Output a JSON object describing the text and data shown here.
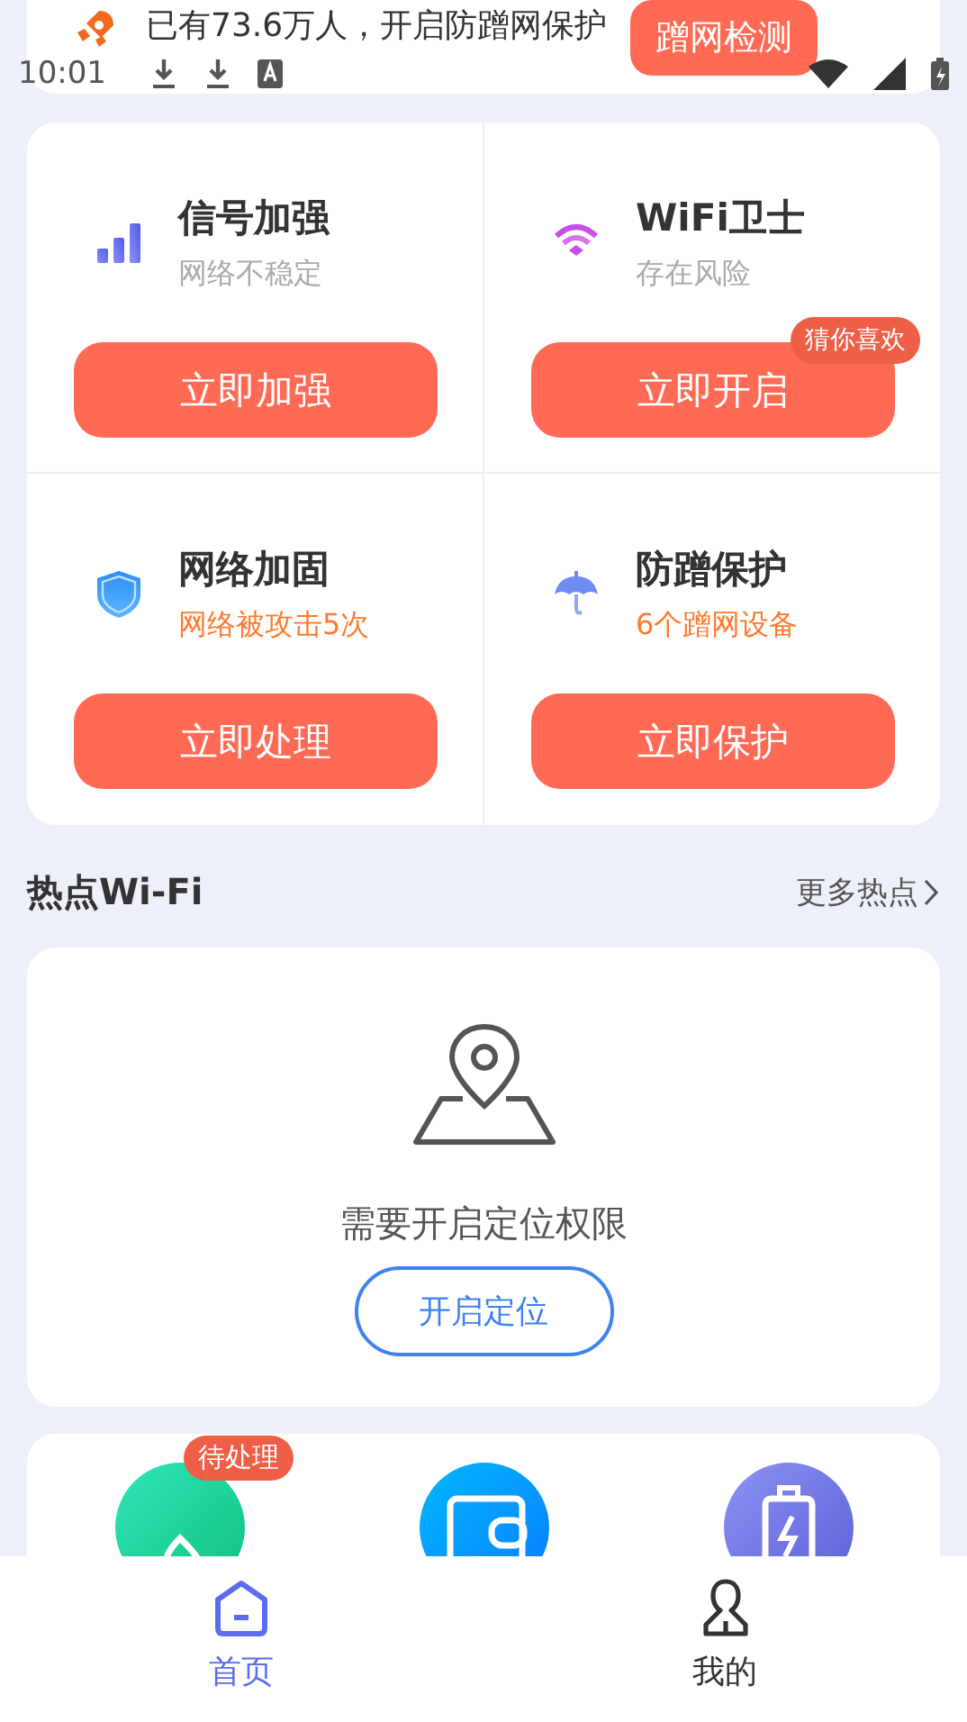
{
  "status_bar": {
    "time": "10:01"
  },
  "banner": {
    "text": "已有73.6万人，开启防蹭网保护",
    "button": "蹭网检测"
  },
  "tools": [
    {
      "kind": "signal",
      "title": "信号加强",
      "subtitle": "网络不稳定",
      "alert": false,
      "button": "立即加强"
    },
    {
      "kind": "wifi",
      "title": "WiFi卫士",
      "subtitle": "存在风险",
      "alert": false,
      "button": "立即开启",
      "badge": "猜你喜欢"
    },
    {
      "kind": "shield",
      "title": "网络加固",
      "subtitle": "网络被攻击5次",
      "alert": true,
      "button": "立即处理"
    },
    {
      "kind": "umbrella",
      "title": "防蹭保护",
      "subtitle": "6个蹭网设备",
      "alert": true,
      "button": "立即保护"
    }
  ],
  "hotspot": {
    "title": "热点Wi-Fi",
    "more_link": "更多热点",
    "location_message": "需要开启定位权限",
    "location_button": "开启定位"
  },
  "features": [
    {
      "kind": "drop",
      "badge": "待处理"
    },
    {
      "kind": "wallet"
    },
    {
      "kind": "battery"
    }
  ],
  "nav": [
    {
      "label": "首页",
      "kind": "home",
      "selected": true
    },
    {
      "label": "我的",
      "kind": "person",
      "selected": false
    }
  ]
}
